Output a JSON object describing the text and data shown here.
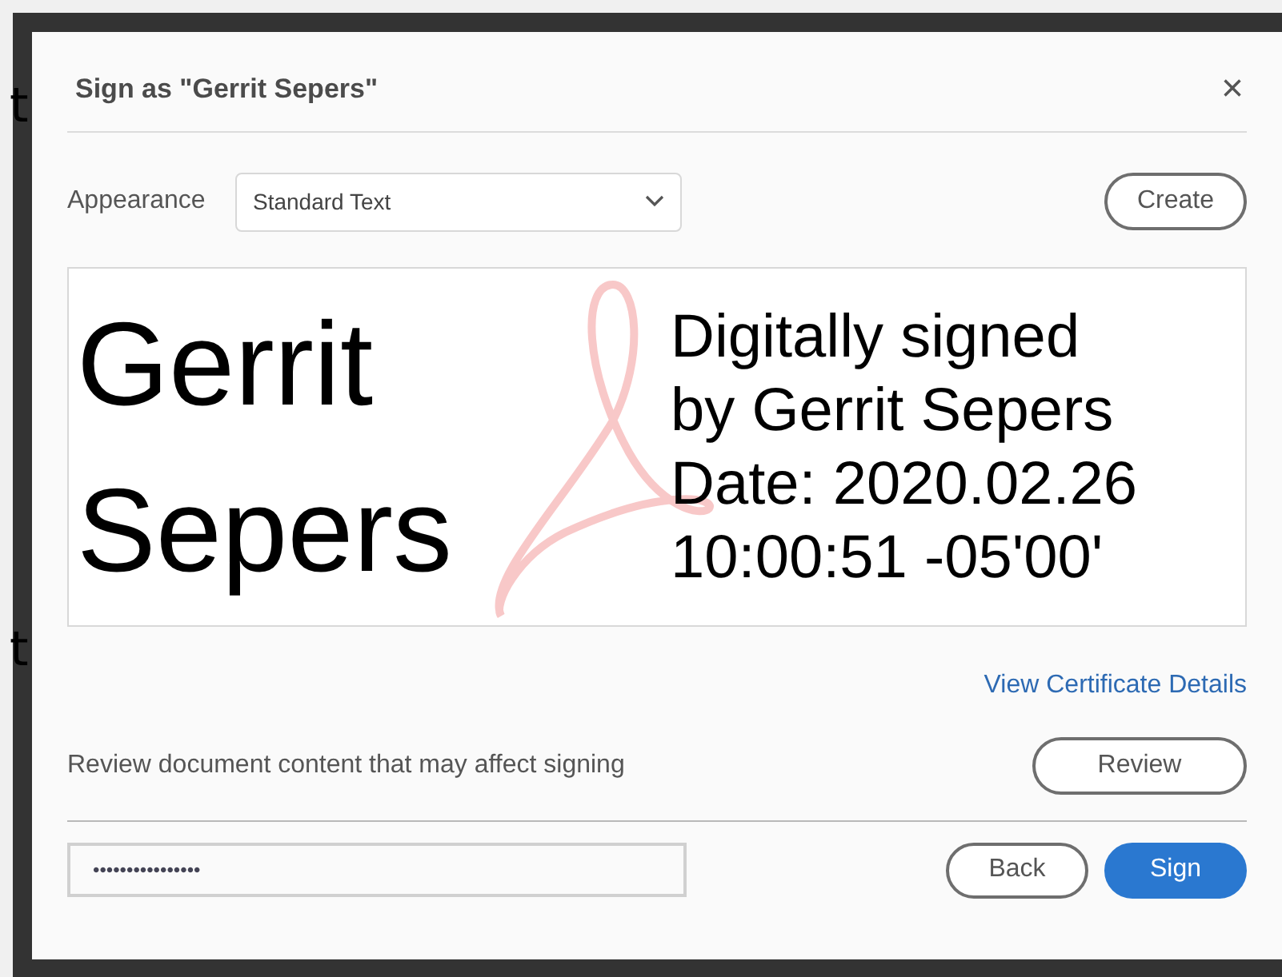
{
  "background_fragments": [
    "t",
    "t"
  ],
  "dialog": {
    "title": "Sign as \"Gerrit Sepers\"",
    "close": "×",
    "appearance": {
      "label": "Appearance",
      "value": "Standard Text"
    },
    "create_button": "Create",
    "preview": {
      "name_lines": [
        "Gerrit",
        "Sepers"
      ],
      "detail_lines": [
        "Digitally signed",
        "by Gerrit Sepers",
        "Date: 2020.02.26",
        "10:00:51 -05'00'"
      ]
    },
    "certificate_link": "View Certificate Details",
    "review_text": "Review document content that may affect signing",
    "review_button": "Review",
    "password": {
      "value": "••••••••••••••••"
    },
    "buttons": [
      {
        "label": "Back",
        "kind": "secondary"
      },
      {
        "label": "Sign",
        "kind": "primary"
      }
    ]
  }
}
